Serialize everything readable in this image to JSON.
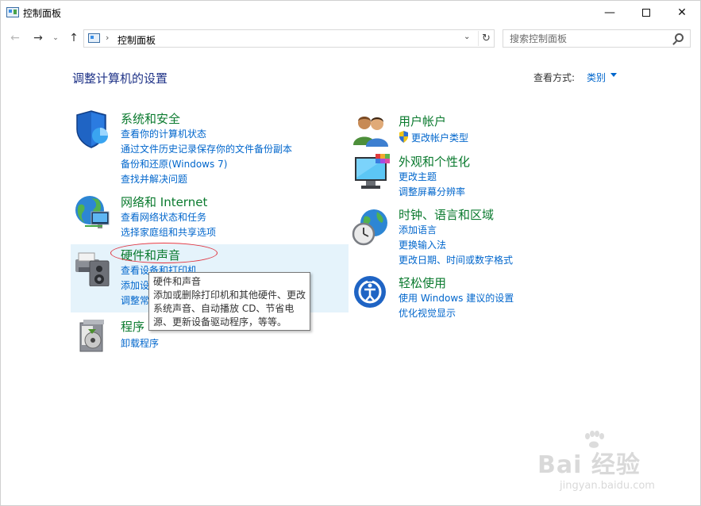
{
  "window": {
    "title": "控制面板",
    "minimize": "—",
    "close": "✕"
  },
  "nav": {
    "back": "←",
    "forward": "→",
    "recent": "⌄",
    "up": "↑",
    "address_separator": "›",
    "address_text": "控制面板",
    "address_dropdown": "⌄",
    "refresh": "↻",
    "search_placeholder": "搜索控制面板"
  },
  "main": {
    "heading": "调整计算机的设置",
    "view_by_label": "查看方式:",
    "view_by_value": "类别"
  },
  "categories": [
    {
      "title": "系统和安全",
      "links": [
        "查看你的计算机状态",
        "通过文件历史记录保存你的文件备份副本",
        "备份和还原(Windows 7)",
        "查找并解决问题"
      ]
    },
    {
      "title": "网络和 Internet",
      "links": [
        "查看网络状态和任务",
        "选择家庭组和共享选项"
      ]
    },
    {
      "title": "硬件和声音",
      "links": [
        "查看设备和打印机",
        "添加设",
        "调整常"
      ]
    },
    {
      "title": "程序",
      "links": [
        "卸载程序"
      ]
    },
    {
      "title": "用户帐户",
      "links": [
        "更改帐户类型"
      ]
    },
    {
      "title": "外观和个性化",
      "links": [
        "更改主题",
        "调整屏幕分辨率"
      ]
    },
    {
      "title": "时钟、语言和区域",
      "links": [
        "添加语言",
        "更换输入法",
        "更改日期、时间或数字格式"
      ]
    },
    {
      "title": "轻松使用",
      "links": [
        "使用 Windows 建议的设置",
        "优化视觉显示"
      ]
    }
  ],
  "tooltip": {
    "title": "硬件和声音",
    "body": "添加或删除打印机和其他硬件、更改系统声音、自动播放 CD、节省电源、更新设备驱动程序，等等。"
  },
  "watermark": {
    "text": "Bai 经验",
    "sub": "jingyan.baidu.com"
  },
  "colors": {
    "category_title": "#0a7a2e",
    "link": "#0066cc",
    "heading": "#1e3287",
    "hover_bg": "#e5f3fb",
    "annotation": "#e0333f"
  }
}
